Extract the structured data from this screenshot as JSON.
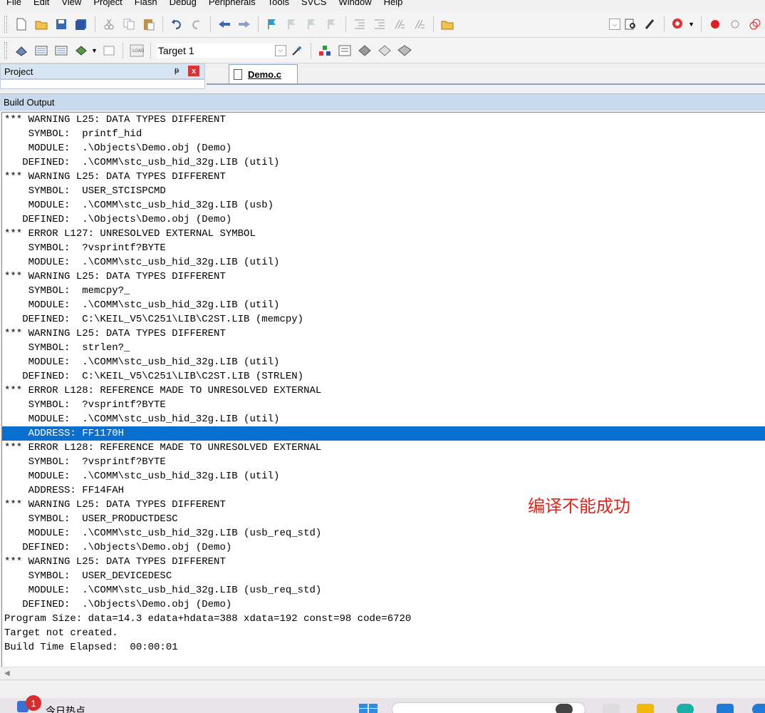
{
  "menu": {
    "items": [
      "File",
      "Edit",
      "View",
      "Project",
      "Flash",
      "Debug",
      "Peripherals",
      "Tools",
      "SVCS",
      "Window",
      "Help"
    ]
  },
  "toolbar2": {
    "target_label": "Target 1"
  },
  "project_panel": {
    "title": "Project",
    "pin": "ᵽ",
    "close": "x"
  },
  "editor": {
    "tab_label": "Demo.c"
  },
  "build_output": {
    "title": "Build Output",
    "lines": [
      "*** WARNING L25: DATA TYPES DIFFERENT",
      "    SYMBOL:  printf_hid",
      "    MODULE:  .\\Objects\\Demo.obj (Demo)",
      "   DEFINED:  .\\COMM\\stc_usb_hid_32g.LIB (util)",
      "*** WARNING L25: DATA TYPES DIFFERENT",
      "    SYMBOL:  USER_STCISPCMD",
      "    MODULE:  .\\COMM\\stc_usb_hid_32g.LIB (usb)",
      "   DEFINED:  .\\Objects\\Demo.obj (Demo)",
      "*** ERROR L127: UNRESOLVED EXTERNAL SYMBOL",
      "    SYMBOL:  ?vsprintf?BYTE",
      "    MODULE:  .\\COMM\\stc_usb_hid_32g.LIB (util)",
      "*** WARNING L25: DATA TYPES DIFFERENT",
      "    SYMBOL:  memcpy?_",
      "    MODULE:  .\\COMM\\stc_usb_hid_32g.LIB (util)",
      "   DEFINED:  C:\\KEIL_V5\\C251\\LIB\\C2ST.LIB (memcpy)",
      "*** WARNING L25: DATA TYPES DIFFERENT",
      "    SYMBOL:  strlen?_",
      "    MODULE:  .\\COMM\\stc_usb_hid_32g.LIB (util)",
      "   DEFINED:  C:\\KEIL_V5\\C251\\LIB\\C2ST.LIB (STRLEN)",
      "*** ERROR L128: REFERENCE MADE TO UNRESOLVED EXTERNAL",
      "    SYMBOL:  ?vsprintf?BYTE",
      "    MODULE:  .\\COMM\\stc_usb_hid_32g.LIB (util)",
      "    ADDRESS: FF1170H",
      "*** ERROR L128: REFERENCE MADE TO UNRESOLVED EXTERNAL",
      "    SYMBOL:  ?vsprintf?BYTE",
      "    MODULE:  .\\COMM\\stc_usb_hid_32g.LIB (util)",
      "    ADDRESS: FF14FAH",
      "*** WARNING L25: DATA TYPES DIFFERENT",
      "    SYMBOL:  USER_PRODUCTDESC",
      "    MODULE:  .\\COMM\\stc_usb_hid_32g.LIB (usb_req_std)",
      "   DEFINED:  .\\Objects\\Demo.obj (Demo)",
      "*** WARNING L25: DATA TYPES DIFFERENT",
      "    SYMBOL:  USER_DEVICEDESC",
      "    MODULE:  .\\COMM\\stc_usb_hid_32g.LIB (usb_req_std)",
      "   DEFINED:  .\\Objects\\Demo.obj (Demo)",
      "Program Size: data=14.3 edata+hdata=388 xdata=192 const=98 code=6720",
      "Target not created.",
      "Build Time Elapsed:  00:00:01"
    ],
    "selected_line_index": 22,
    "annotation": "编译不能成功"
  },
  "taskbar": {
    "news_badge": "1",
    "news_text": "今日热点"
  },
  "colors": {
    "selection": "#0a70d0",
    "annotation": "#e0251a",
    "panel_header": "#c9daec"
  }
}
